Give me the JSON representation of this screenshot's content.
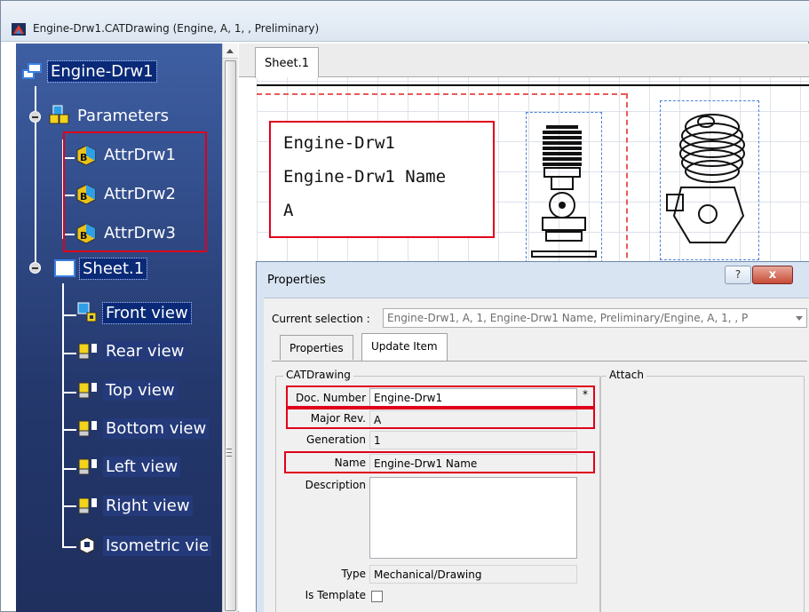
{
  "window": {
    "title": "Engine-Drw1.CATDrawing (Engine, A, 1, , Preliminary)"
  },
  "tree": {
    "root": "Engine-Drw1",
    "parameters": "Parameters",
    "attrs": [
      "AttrDrw1",
      "AttrDrw2",
      "AttrDrw3"
    ],
    "sheet": "Sheet.1",
    "views": [
      "Front view",
      "Rear view",
      "Top view",
      "Bottom view",
      "Left view",
      "Right view",
      "Isometric vie"
    ]
  },
  "drawing": {
    "sheet_tab": "Sheet.1",
    "title_block": {
      "line1": "Engine-Drw1",
      "line2": "Engine-Drw1 Name",
      "line3": "A"
    }
  },
  "dialog": {
    "title": "Properties",
    "help": "?",
    "close": "x",
    "current_selection_label": "Current selection :",
    "current_selection_value": "Engine-Drw1, A, 1, Engine-Drw1 Name, Preliminary/Engine, A, 1, , P",
    "tabs": [
      "Properties",
      "Update Item"
    ],
    "group_catdrawing": "CATDrawing",
    "group_attach": "Attach",
    "fields": {
      "doc_number_label": "Doc. Number",
      "doc_number_value": "Engine-Drw1",
      "doc_number_marker": "*",
      "major_rev_label": "Major Rev.",
      "major_rev_value": "A",
      "generation_label": "Generation",
      "generation_value": "1",
      "name_label": "Name",
      "name_value": "Engine-Drw1 Name",
      "description_label": "Description",
      "description_value": "",
      "type_label": "Type",
      "type_value": "Mechanical/Drawing",
      "is_template_label": "Is Template"
    }
  }
}
